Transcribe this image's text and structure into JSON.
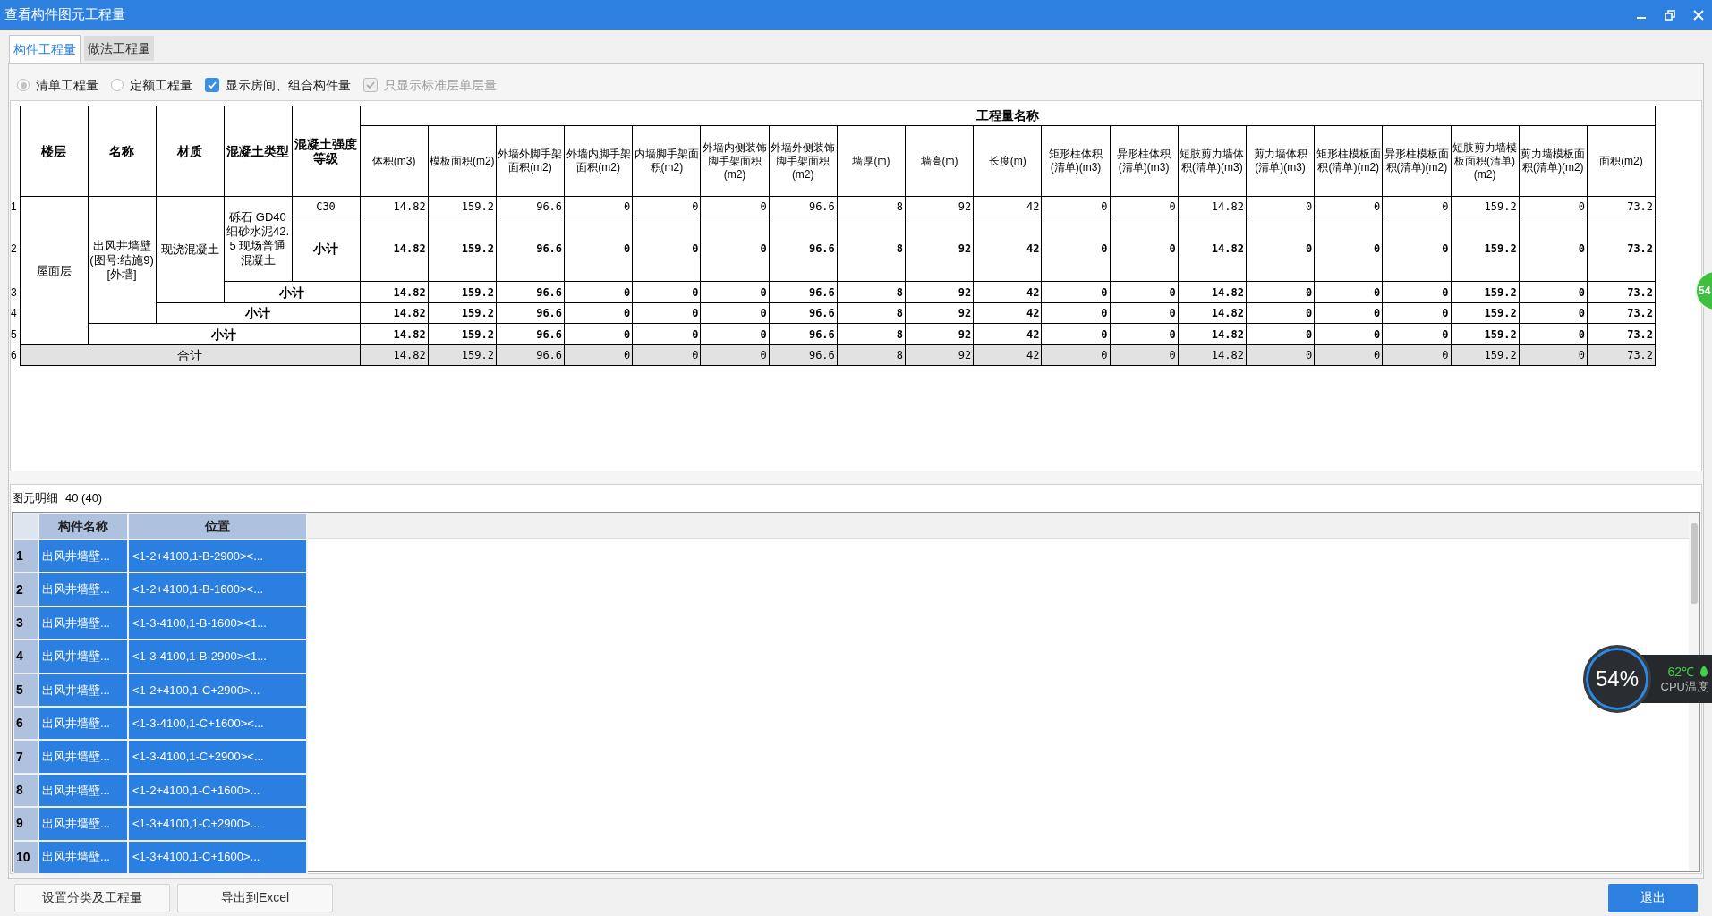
{
  "window": {
    "title": "查看构件图元工程量"
  },
  "tabs": [
    {
      "label": "构件工程量",
      "selected": true
    },
    {
      "label": "做法工程量",
      "selected": false
    }
  ],
  "options": [
    {
      "kind": "radio",
      "label": "清单工程量",
      "checked": true,
      "disabled": false
    },
    {
      "kind": "radio",
      "label": "定额工程量",
      "checked": false,
      "disabled": false
    },
    {
      "kind": "checkbox",
      "label": "显示房间、组合构件量",
      "checked": true,
      "disabled": false
    },
    {
      "kind": "checkbox",
      "label": "只显示标准层单层量",
      "checked": true,
      "disabled": true
    }
  ],
  "quantity_table": {
    "fixed_columns": [
      "楼层",
      "名称",
      "材质",
      "混凝土类型",
      "混凝土强度等级"
    ],
    "group_header": "工程量名称",
    "quantity_columns": [
      "体积(m3)",
      "模板面积(m2)",
      "外墙外脚手架面积(m2)",
      "外墙内脚手架面积(m2)",
      "内墙脚手架面积(m2)",
      "外墙内侧装饰脚手架面积(m2)",
      "外墙外侧装饰脚手架面积(m2)",
      "墙厚(m)",
      "墙高(m)",
      "长度(m)",
      "矩形柱体积(清单)(m3)",
      "异形柱体积(清单)(m3)",
      "短肢剪力墙体积(清单)(m3)",
      "剪力墙体积(清单)(m3)",
      "矩形柱模板面积(清单)(m2)",
      "异形柱模板面积(清单)(m2)",
      "短肢剪力墙模板面积(清单)(m2)",
      "剪力墙模板面积(清单)(m2)",
      "面积(m2)"
    ],
    "rows": [
      {
        "number": "1",
        "kind": "detail",
        "labels": [
          {
            "text": "屋面层",
            "rowspan": 5
          },
          {
            "text": "出风井墙壁(图号:结施9)[外墙]",
            "rowspan": 4
          },
          {
            "text": "现浇混凝土",
            "rowspan": 3
          },
          {
            "text": "砾石 GD40细砂水泥42.5 现场普通混凝土",
            "rowspan": 2
          },
          {
            "text": "C30"
          }
        ],
        "values": [
          "14.82",
          "159.2",
          "96.6",
          "0",
          "0",
          "0",
          "96.6",
          "8",
          "92",
          "42",
          "0",
          "0",
          "14.82",
          "0",
          "0",
          "0",
          "159.2",
          "0",
          "73.2"
        ]
      },
      {
        "number": "2",
        "kind": "subtotal",
        "labels": [
          {
            "text": "小计"
          }
        ],
        "values": [
          "14.82",
          "159.2",
          "96.6",
          "0",
          "0",
          "0",
          "96.6",
          "8",
          "92",
          "42",
          "0",
          "0",
          "14.82",
          "0",
          "0",
          "0",
          "159.2",
          "0",
          "73.2"
        ]
      },
      {
        "number": "3",
        "kind": "subtotal",
        "labels": [
          {
            "text": "小计",
            "colspan": 2
          }
        ],
        "values": [
          "14.82",
          "159.2",
          "96.6",
          "0",
          "0",
          "0",
          "96.6",
          "8",
          "92",
          "42",
          "0",
          "0",
          "14.82",
          "0",
          "0",
          "0",
          "159.2",
          "0",
          "73.2"
        ]
      },
      {
        "number": "4",
        "kind": "subtotal",
        "labels": [
          {
            "text": "小计",
            "colspan": 3
          }
        ],
        "values": [
          "14.82",
          "159.2",
          "96.6",
          "0",
          "0",
          "0",
          "96.6",
          "8",
          "92",
          "42",
          "0",
          "0",
          "14.82",
          "0",
          "0",
          "0",
          "159.2",
          "0",
          "73.2"
        ]
      },
      {
        "number": "5",
        "kind": "subtotal",
        "labels": [
          {
            "text": "小计",
            "colspan": 4
          }
        ],
        "values": [
          "14.82",
          "159.2",
          "96.6",
          "0",
          "0",
          "0",
          "96.6",
          "8",
          "92",
          "42",
          "0",
          "0",
          "14.82",
          "0",
          "0",
          "0",
          "159.2",
          "0",
          "73.2"
        ]
      },
      {
        "number": "6",
        "kind": "total",
        "labels": [
          {
            "text": "合计",
            "colspan": 5
          }
        ],
        "values": [
          "14.82",
          "159.2",
          "96.6",
          "0",
          "0",
          "0",
          "96.6",
          "8",
          "92",
          "42",
          "0",
          "0",
          "14.82",
          "0",
          "0",
          "0",
          "159.2",
          "0",
          "73.2"
        ]
      }
    ]
  },
  "detail_list": {
    "title": "图元明细",
    "count": "40 (40)",
    "columns": [
      "构件名称",
      "位置"
    ],
    "rows": [
      {
        "number": "1",
        "name": "出风井墙壁...",
        "position": "<1-2+4100,1-B-2900><...",
        "selected": true
      },
      {
        "number": "2",
        "name": "出风井墙壁...",
        "position": "<1-2+4100,1-B-1600><...",
        "selected": true
      },
      {
        "number": "3",
        "name": "出风井墙壁...",
        "position": "<1-3-4100,1-B-1600><1...",
        "selected": true
      },
      {
        "number": "4",
        "name": "出风井墙壁...",
        "position": "<1-3-4100,1-B-2900><1...",
        "selected": true
      },
      {
        "number": "5",
        "name": "出风井墙壁...",
        "position": "<1-2+4100,1-C+2900>...",
        "selected": true
      },
      {
        "number": "6",
        "name": "出风井墙壁...",
        "position": "<1-3-4100,1-C+1600><...",
        "selected": true
      },
      {
        "number": "7",
        "name": "出风井墙壁...",
        "position": "<1-3-4100,1-C+2900><...",
        "selected": true
      },
      {
        "number": "8",
        "name": "出风井墙壁...",
        "position": "<1-2+4100,1-C+1600>...",
        "selected": true
      },
      {
        "number": "9",
        "name": "出风井墙壁...",
        "position": "<1-3+4100,1-C+2900>...",
        "selected": true
      },
      {
        "number": "10",
        "name": "出风井墙壁...",
        "position": "<1-3+4100,1-C+1600>...",
        "selected": true
      }
    ]
  },
  "buttons": [
    {
      "label": "设置分类及工程量",
      "kind": "default"
    },
    {
      "label": "导出到Excel",
      "kind": "default"
    },
    {
      "label": "退出",
      "kind": "primary"
    }
  ],
  "cpu_widget": {
    "usage": "54%",
    "temperature": "62℃",
    "label": "CPU温度"
  },
  "side_ball": {
    "text": "54"
  }
}
